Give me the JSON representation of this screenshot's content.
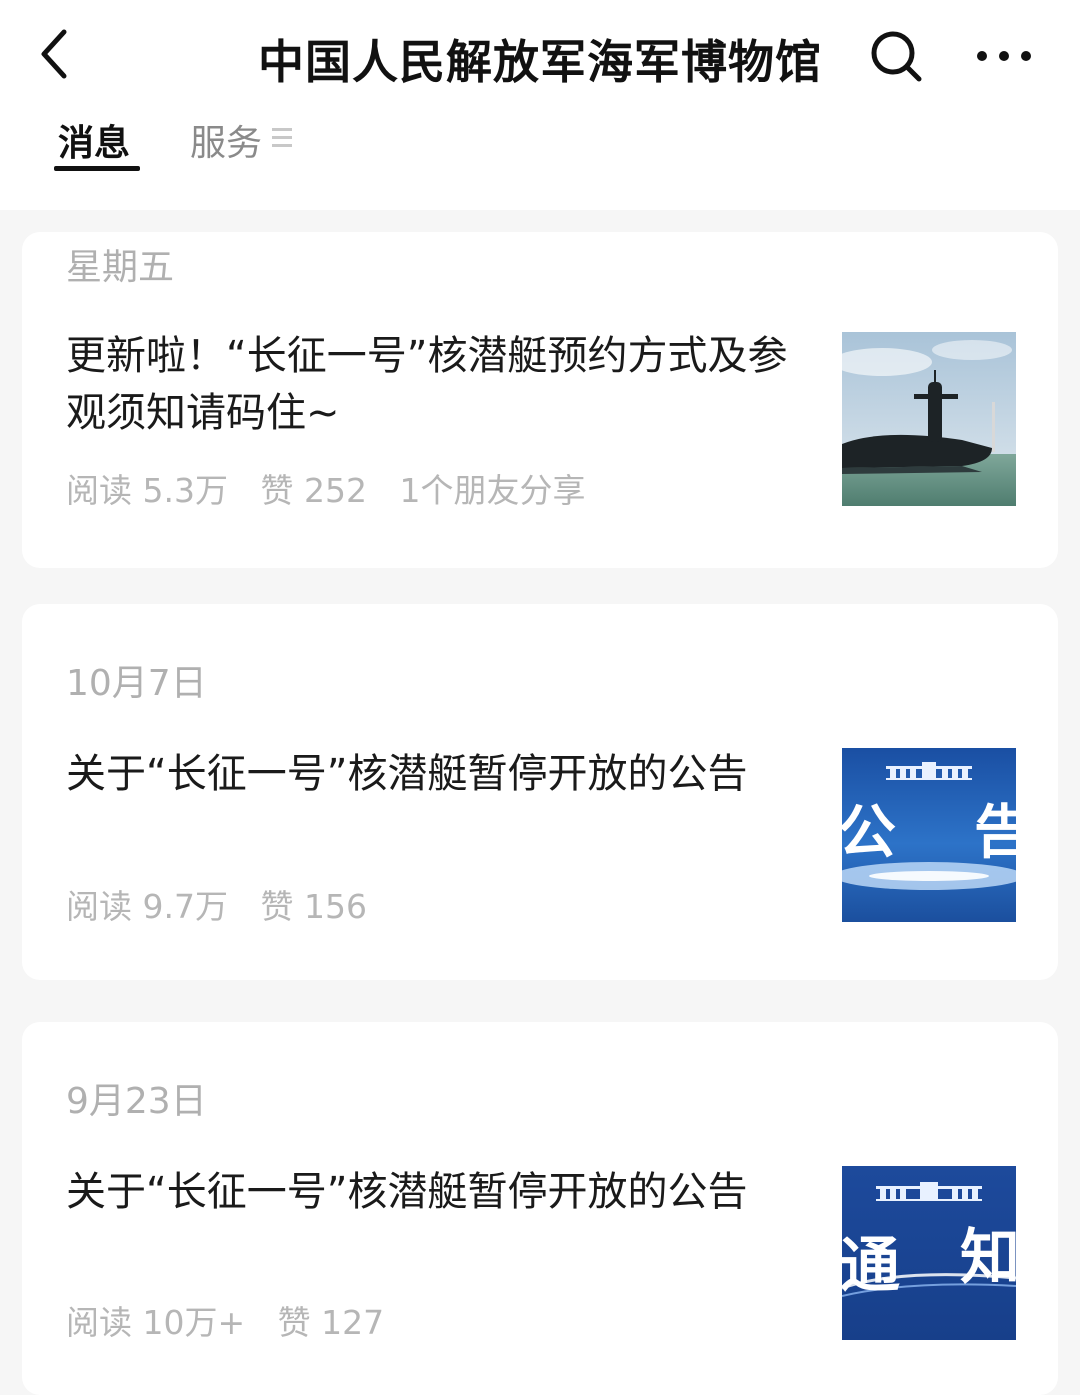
{
  "header": {
    "title": "中国人民解放军海军博物馆"
  },
  "tabs": {
    "messages": "消息",
    "services": "服务"
  },
  "articles": [
    {
      "date": "星期五",
      "title": "更新啦！“长征一号”核潜艇预约方式及参观须知请码住~",
      "reads": "阅读 5.3万",
      "likes": "赞 252",
      "shares": "1个朋友分享",
      "thumb_icon": "submarine-photo"
    },
    {
      "date": "10月7日",
      "title": "关于“长征一号”核潜艇暂停开放的公告",
      "reads": "阅读 9.7万",
      "likes": "赞 156",
      "thumb_text_left": "公",
      "thumb_text_right": "告",
      "thumb_icon": "announcement-banner"
    },
    {
      "date": "9月23日",
      "title": "关于“长征一号”核潜艇暂停开放的公告",
      "reads": "阅读 10万+",
      "likes": "赞 127",
      "thumb_text_left": "通",
      "thumb_text_right": "知",
      "thumb_icon": "notice-banner"
    }
  ],
  "colors": {
    "background": "#f6f6f6",
    "card": "#ffffff",
    "meta_text": "#b6b6b6",
    "thumb_blue": "#1f5bb0"
  }
}
